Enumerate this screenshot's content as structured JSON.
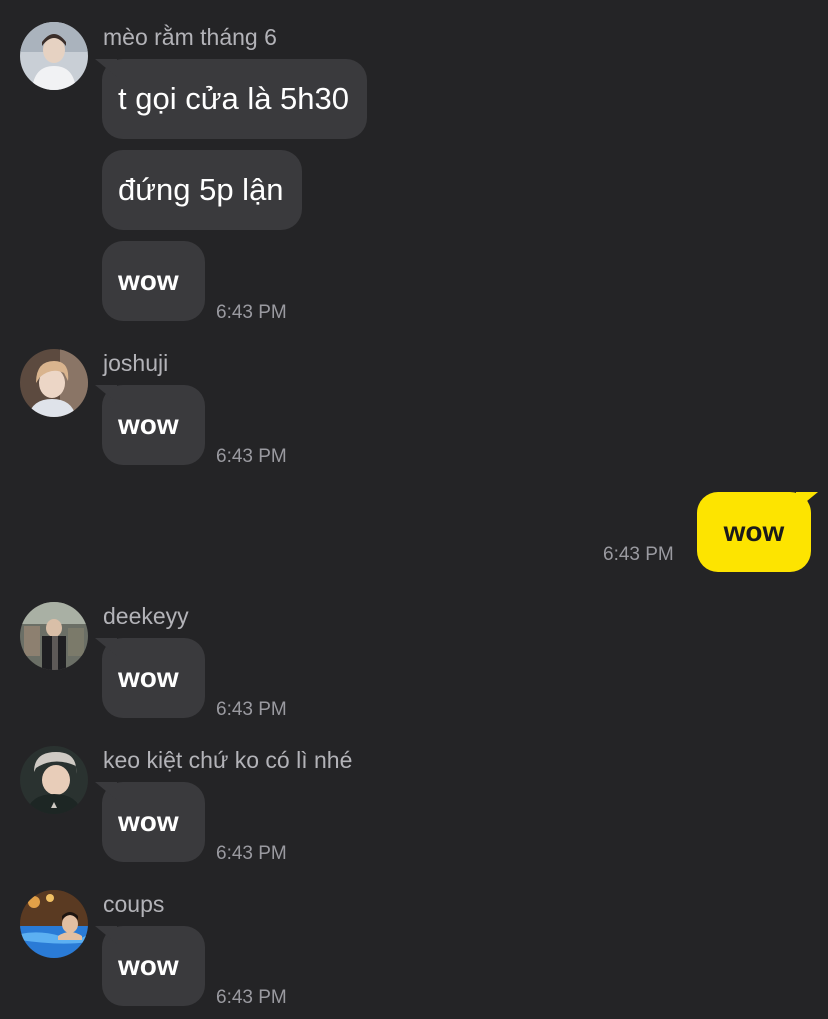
{
  "messages": {
    "m1": {
      "sender": "mèo rằm tháng 6",
      "bubbles": [
        "t gọi cửa là 5h30",
        "đứng 5p lận",
        "wow"
      ],
      "time": "6:43 PM"
    },
    "m2": {
      "sender": "joshuji",
      "text": "wow",
      "time": "6:43 PM"
    },
    "mine": {
      "text": "wow",
      "time": "6:43 PM"
    },
    "m3": {
      "sender": "deekeyy",
      "text": "wow",
      "time": "6:43 PM"
    },
    "m4": {
      "sender": "keo kiệt chứ ko có lì nhé",
      "text": "wow",
      "time": "6:43 PM"
    },
    "m5": {
      "sender": "coups",
      "text": "wow",
      "time": "6:43 PM"
    }
  },
  "colors": {
    "background": "#242426",
    "incoming_bubble": "#3a3a3d",
    "outgoing_bubble": "#fde400",
    "name_text": "#b3b3b8",
    "time_text": "#9a9aa0"
  }
}
